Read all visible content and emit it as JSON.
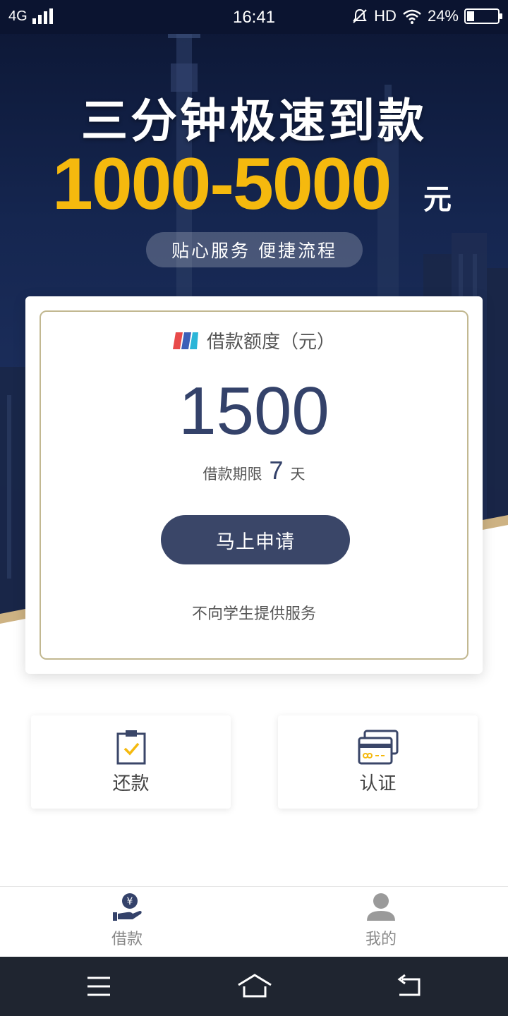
{
  "status_bar": {
    "network": "4G",
    "time": "16:41",
    "hd": "HD",
    "battery": "24%",
    "battery_level": 0.24
  },
  "hero": {
    "headline": "三分钟极速到款",
    "amount_range": "1000-5000",
    "amount_unit": "元",
    "tagline": "贴心服务 便捷流程"
  },
  "card": {
    "title": "借款额度（元）",
    "quota": "1500",
    "term_label": "借款期限",
    "term_value": "7",
    "term_unit": "天",
    "apply_label": "马上申请",
    "notice": "不向学生提供服务"
  },
  "tiles": [
    {
      "label": "还款",
      "icon": "clipboard-check-icon"
    },
    {
      "label": "认证",
      "icon": "id-card-icon"
    }
  ],
  "tab_bar": {
    "items": [
      {
        "label": "借款",
        "icon": "hand-money-icon",
        "active": true
      },
      {
        "label": "我的",
        "icon": "person-icon",
        "active": false
      }
    ]
  },
  "nav_bar": {
    "buttons": [
      "menu-icon",
      "home-icon",
      "back-icon"
    ]
  },
  "colors": {
    "accent_navy": "#3a4668",
    "gold": "#f5b90e",
    "card_border": "#c2b891",
    "hero_bg": "#152650"
  }
}
